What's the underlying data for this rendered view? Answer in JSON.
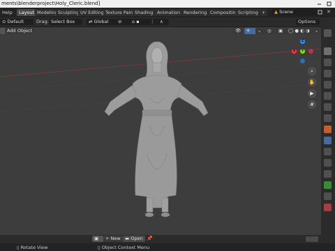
{
  "window": {
    "title": "ments\\blenderproject\\Holy_Cleric.blend]"
  },
  "menubar": {
    "help": "Help",
    "workspaces": [
      "Layout",
      "Modeling",
      "Sculpting",
      "UV Editing",
      "Texture Paint",
      "Shading",
      "Animation",
      "Rendering",
      "Compositing",
      "Scripting"
    ],
    "active_workspace": "Layout",
    "add_tab": "+",
    "scene": "Scene"
  },
  "toolbar": {
    "orientation_value": "Default",
    "drag_label": "Drag:",
    "drag_value": "Select Box",
    "transform_orientation": "Global",
    "options": "Options"
  },
  "header2": {
    "add": "Add",
    "object": "Object"
  },
  "viewport": {
    "axes": {
      "x": "X",
      "y": "Y",
      "z": "Z"
    },
    "colors": {
      "x_axis": "#ff3352",
      "y_axis": "#8bdc00",
      "z_axis": "#2890ff",
      "grid_bg": "#3d3d3d"
    }
  },
  "bottombar": {
    "new": "New",
    "open": "Open"
  },
  "status": {
    "left": "Rotate View",
    "right": "Object Context Menu"
  }
}
